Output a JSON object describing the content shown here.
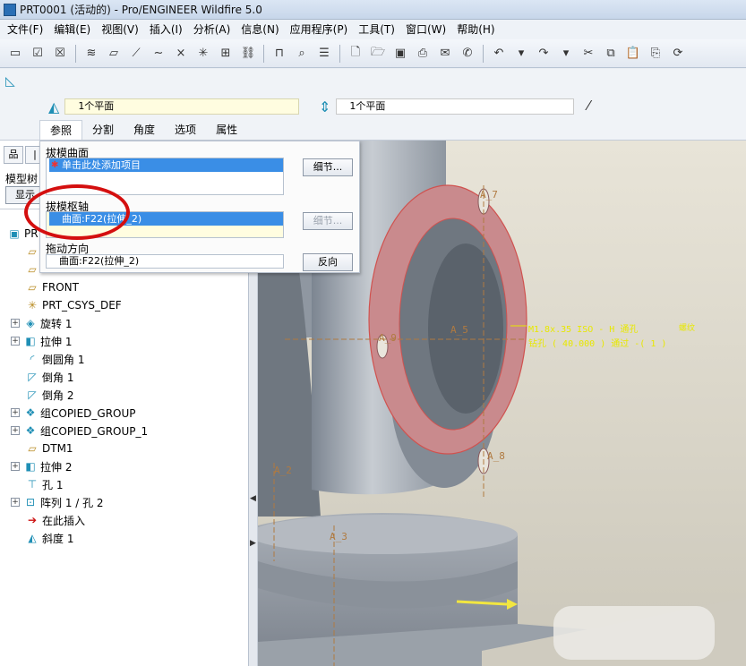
{
  "window": {
    "title": "PRT0001 (活动的) - Pro/ENGINEER Wildfire 5.0"
  },
  "menu": [
    "文件(F)",
    "编辑(E)",
    "视图(V)",
    "插入(I)",
    "分析(A)",
    "信息(N)",
    "应用程序(P)",
    "工具(T)",
    "窗口(W)",
    "帮助(H)"
  ],
  "dashboard": {
    "left_collector": "1个平面",
    "right_collector": "1个平面",
    "tabs": [
      "参照",
      "分割",
      "角度",
      "选项",
      "属性"
    ],
    "active_tab": "参照"
  },
  "references_panel": {
    "draft_surfaces_label": "拔模曲面",
    "draft_surfaces_value": "单击此处添加项目",
    "details_button": "细节...",
    "draft_hinges_label": "拔模枢轴",
    "draft_hinges_value": "曲面:F22(拉伸_2)",
    "details_button_2": "细节...",
    "pull_direction_label": "拖动方向",
    "pull_direction_value": "曲面:F22(拉伸_2)",
    "flip_button": "反向"
  },
  "model_tree": {
    "tab_label": "模型树",
    "show_button": "显示",
    "root": "PR",
    "items": [
      {
        "label": "",
        "icon": "datum-plane-icon",
        "expandable": false
      },
      {
        "label": "",
        "icon": "datum-plane-icon",
        "expandable": false
      },
      {
        "label": "FRONT",
        "icon": "datum-plane-icon",
        "expandable": false
      },
      {
        "label": "PRT_CSYS_DEF",
        "icon": "csys-icon",
        "expandable": false
      },
      {
        "label": "旋转 1",
        "icon": "revolve-icon",
        "expandable": true
      },
      {
        "label": "拉伸 1",
        "icon": "extrude-icon",
        "expandable": true
      },
      {
        "label": "倒圆角 1",
        "icon": "round-icon",
        "expandable": false
      },
      {
        "label": "倒角 1",
        "icon": "chamfer-icon",
        "expandable": false
      },
      {
        "label": "倒角 2",
        "icon": "chamfer-icon",
        "expandable": false
      },
      {
        "label": "组COPIED_GROUP",
        "icon": "group-icon",
        "expandable": true
      },
      {
        "label": "组COPIED_GROUP_1",
        "icon": "group-icon",
        "expandable": true
      },
      {
        "label": "DTM1",
        "icon": "datum-plane-icon",
        "expandable": false
      },
      {
        "label": "拉伸 2",
        "icon": "extrude-icon",
        "expandable": true
      },
      {
        "label": "孔 1",
        "icon": "hole-icon",
        "expandable": false
      },
      {
        "label": "阵列 1 / 孔 2",
        "icon": "pattern-icon",
        "expandable": true
      },
      {
        "label": "在此插入",
        "icon": "insert-here-icon",
        "expandable": false
      },
      {
        "label": "斜度 1",
        "icon": "draft-icon",
        "expandable": false
      }
    ]
  },
  "viewport": {
    "axis_labels": [
      "A_7",
      "A_9",
      "A_5",
      "A_8",
      "A_2",
      "A_3"
    ],
    "hole_note_line1": "M1.8x.35 ISO - H 通孔",
    "hole_note_line2": "钻孔 ( 40.000 ) 通过 -( 1 )",
    "hole_note_line2b": "螺纹"
  },
  "colors": {
    "face_highlight": "#c98a8d",
    "annotation": "#e8e800",
    "selection": "#3a8ee6",
    "circle": "#d40f0f"
  }
}
